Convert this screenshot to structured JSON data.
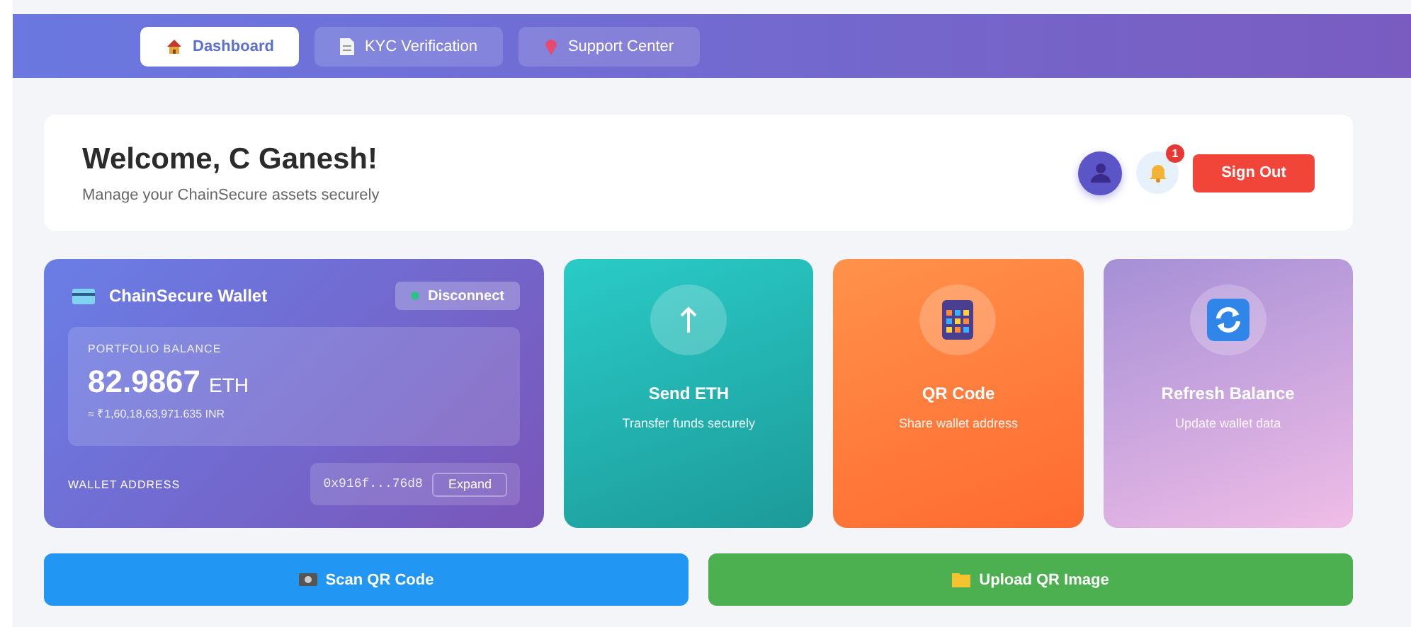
{
  "nav": {
    "tabs": [
      {
        "label": "Dashboard",
        "kind": "house",
        "selected": true
      },
      {
        "label": "KYC Verification",
        "kind": "document",
        "selected": false
      },
      {
        "label": "Support Center",
        "kind": "pin",
        "selected": false
      }
    ]
  },
  "header": {
    "title": "Welcome, C Ganesh!",
    "subtitle": "Manage your ChainSecure assets securely",
    "notification_count": "1",
    "sign_out": "Sign Out"
  },
  "wallet": {
    "title": "ChainSecure Wallet",
    "disconnect": "Disconnect",
    "balance_label": "PORTFOLIO BALANCE",
    "balance": "82.9867",
    "unit": "ETH",
    "fiat": "≈ ₹1,60,18,63,971.635 INR",
    "address_label": "WALLET ADDRESS",
    "address": "0x916f...76d8",
    "expand": "Expand"
  },
  "actions": [
    {
      "kind": "send",
      "title": "Send ETH",
      "subtitle": "Transfer funds securely"
    },
    {
      "kind": "qr",
      "title": "QR Code",
      "subtitle": "Share wallet address"
    },
    {
      "kind": "refresh",
      "title": "Refresh Balance",
      "subtitle": "Update wallet data"
    }
  ],
  "buttons": [
    {
      "kind": "scan",
      "label": "Scan QR Code"
    },
    {
      "kind": "upload",
      "label": "Upload QR Image"
    }
  ]
}
